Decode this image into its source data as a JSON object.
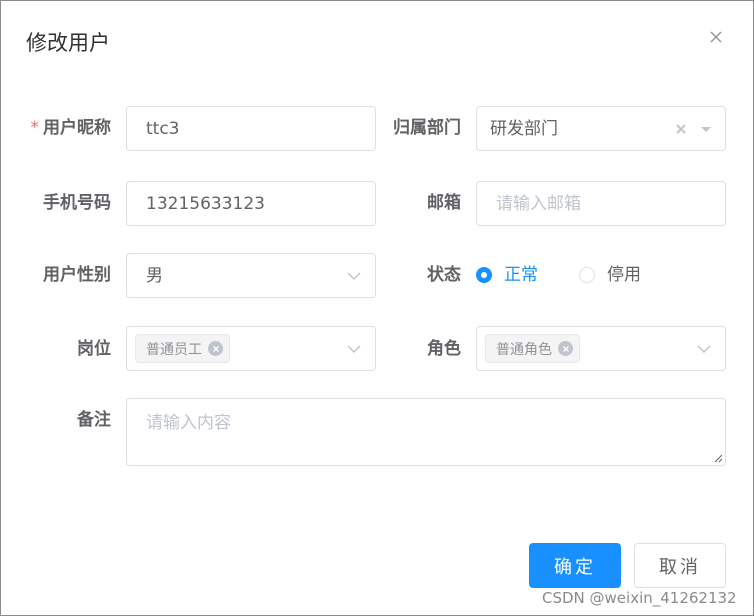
{
  "dialog": {
    "title": "修改用户"
  },
  "form": {
    "nickname": {
      "label": "用户昵称",
      "required_mark": "*",
      "value": "ttc3"
    },
    "dept": {
      "label": "归属部门",
      "value": "研发部门"
    },
    "phone": {
      "label": "手机号码",
      "value": "13215633123"
    },
    "email": {
      "label": "邮箱",
      "placeholder": "请输入邮箱"
    },
    "gender": {
      "label": "用户性别",
      "value": "男"
    },
    "status": {
      "label": "状态",
      "options": [
        {
          "label": "正常",
          "selected": true
        },
        {
          "label": "停用",
          "selected": false
        }
      ]
    },
    "post": {
      "label": "岗位",
      "tags": [
        "普通员工"
      ]
    },
    "role": {
      "label": "角色",
      "tags": [
        "普通角色"
      ]
    },
    "remark": {
      "label": "备注",
      "placeholder": "请输入内容"
    }
  },
  "footer": {
    "confirm_label": "确定",
    "cancel_label": "取消"
  },
  "watermark": "CSDN @weixin_41262132",
  "colors": {
    "primary": "#1890ff",
    "required": "#f56c6c",
    "placeholder": "#c0c4cc",
    "border": "#dcdfe6"
  }
}
